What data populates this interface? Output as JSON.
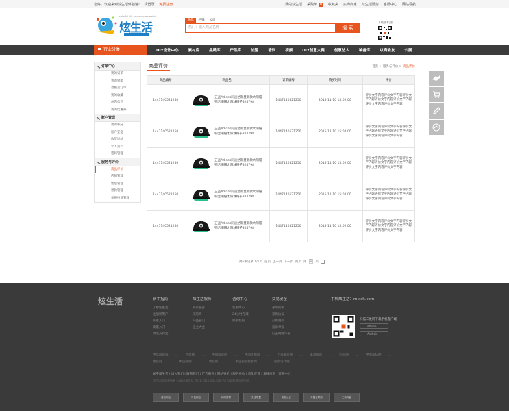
{
  "topbar": {
    "welcome": "您好，欢迎来到炫生活体验馆!",
    "login": "请登录",
    "register": "免费注册",
    "links": [
      "我的炫生活",
      "采购单",
      "收藏夹",
      "买为商家",
      "炫生活服务",
      "客服中心",
      "网站导航"
    ],
    "cart_count": "0"
  },
  "header": {
    "logo_text": "炫生活",
    "search_tabs": [
      "商品",
      "店铺",
      "公司"
    ],
    "search_placeholder": "热门：输入商品名称",
    "search_button": "搜 索",
    "qr_label": "下载手机版"
  },
  "nav": {
    "category": "行业分类",
    "items": [
      "DIY设计中心",
      "素材库",
      "品牌库",
      "产品库",
      "加盟",
      "培训",
      "视频",
      "DIY创意大赛",
      "创意达人",
      "装备库",
      "以商会友",
      "公展"
    ]
  },
  "sidebar": {
    "sections": [
      {
        "title": "订单中心",
        "items": [
          "我的订单",
          "我的销量",
          "退换货订单",
          "我的收藏",
          "站内信息",
          "我的优惠券"
        ]
      },
      {
        "title": "账户管理",
        "items": [
          "我的积分",
          "账户安全",
          "收货地址",
          "个人资料",
          "密码管理"
        ]
      },
      {
        "title": "服务与评价",
        "items": [
          "商品评价",
          "店铺管理",
          "售后管理",
          "退款管理",
          "举报投诉管理"
        ]
      }
    ],
    "active": "商品评价"
  },
  "main": {
    "title": "商品评价",
    "breadcrumb": {
      "home": "首页",
      "sep": ">",
      "mid": "服务与评价",
      "current": "商品评价"
    },
    "headers": [
      "商品编号",
      "商品名",
      "订单编号",
      "购买时间",
      "评价"
    ],
    "rows": [
      {
        "id": "1447140521250",
        "name": "正品Adidas阿迪达斯夏新款大阳帽鸭舌潮帽太阳球帽子324798",
        "order": "1447140521250",
        "time": "2015-11-10 15:02:00",
        "review": "评价文字内容评价文字内容评价文字内容评价文字内容评价文字内容评价文字内容评价文字内容"
      },
      {
        "id": "1447140521250",
        "name": "正品Adidas阿迪达斯夏新款大阳帽鸭舌潮帽太阳球帽子324798",
        "order": "1447140521250",
        "time": "2015-11-10 15:02:00",
        "review": "评价文字内容评价文字内容评价文字内容评价文字内容评价文字内容评价文字内容评价文字内容"
      },
      {
        "id": "1447140521250",
        "name": "正品Adidas阿迪达斯夏新款大阳帽鸭舌潮帽太阳球帽子324798",
        "order": "1447140521250",
        "time": "2015-11-10 15:02:00",
        "review": "评价文字内容评价文字内容评价文字内容评价文字内容评价文字内容评价文字内容评价文字内容"
      },
      {
        "id": "1447140521250",
        "name": "正品Adidas阿迪达斯夏新款大阳帽鸭舌潮帽太阳球帽子324798",
        "order": "1447140521250",
        "time": "2015-11-10 15:02:00",
        "review": "评价文字内容评价文字内容评价文字内容评价文字内容评价文字内容评价文字内容评价文字内容"
      },
      {
        "id": "1447140521250",
        "name": "正品Adidas阿迪达斯夏新款大阳帽鸭舌潮帽太阳球帽子324798",
        "order": "1447140521250",
        "time": "2015-11-10 15:02:00",
        "review": "评价文字内容评价文字内容评价文字内容评价文字内容评价文字内容评价文字内容评价文字内容"
      }
    ]
  },
  "pager": {
    "summary": "共5条记录 1/1页",
    "first": "首页",
    "prev": "上一页",
    "next": "下一页",
    "last": "尾页",
    "goto": "第",
    "page": "1",
    "unit": "页"
  },
  "footer": {
    "logo": "炫生活",
    "cols": [
      {
        "h": "新手指南",
        "items": [
          "了解炫生活",
          "注册新用户",
          "买家入门",
          "卖家入门",
          "绑定支付宝"
        ]
      },
      {
        "h": "炫生活服务",
        "items": [
          "买家服务",
          "采购商",
          "产品部门",
          "企业大全"
        ]
      },
      {
        "h": "咨询中心",
        "items": [
          "客服中心",
          "24小时在线",
          "联系客服"
        ]
      },
      {
        "h": "交易安全",
        "items": [
          "采购指南",
          "采购协议",
          "交易规则",
          "投诉举报",
          "打击网络诈骗"
        ]
      }
    ],
    "mobile_h": "手机炫生活：m.xsh.com",
    "mobile_qr_text": "扫描二维码下载手机客户端",
    "ios": "iPhone",
    "android": "Android",
    "links": "中华网商城 ... 时尚网 ... 中国服装网 ... 中国纺织网 ... 上海服装网 ... 美邦服饰 ... 纺织网 ... 中国家纺网 ... 童装网 ... 中国鞋网 ... 时装网 ... 中国服装批发网 ... 服装设计网",
    "about": "关于炫生活 | 加入我们 | 联系我们 | 广告服务 | 网站导航 | 服务条款 | 意见反馈 | 法律声明 | 客服中心",
    "copy": "炫生活网 版权所有 Copyright © 2011-2015 xsh.com All Rights Reserved",
    "badges": [
      "诚信网站",
      "可信网站",
      "网络警察",
      "安全联盟",
      "实名认证",
      "中国互联网",
      "工商网监"
    ]
  }
}
